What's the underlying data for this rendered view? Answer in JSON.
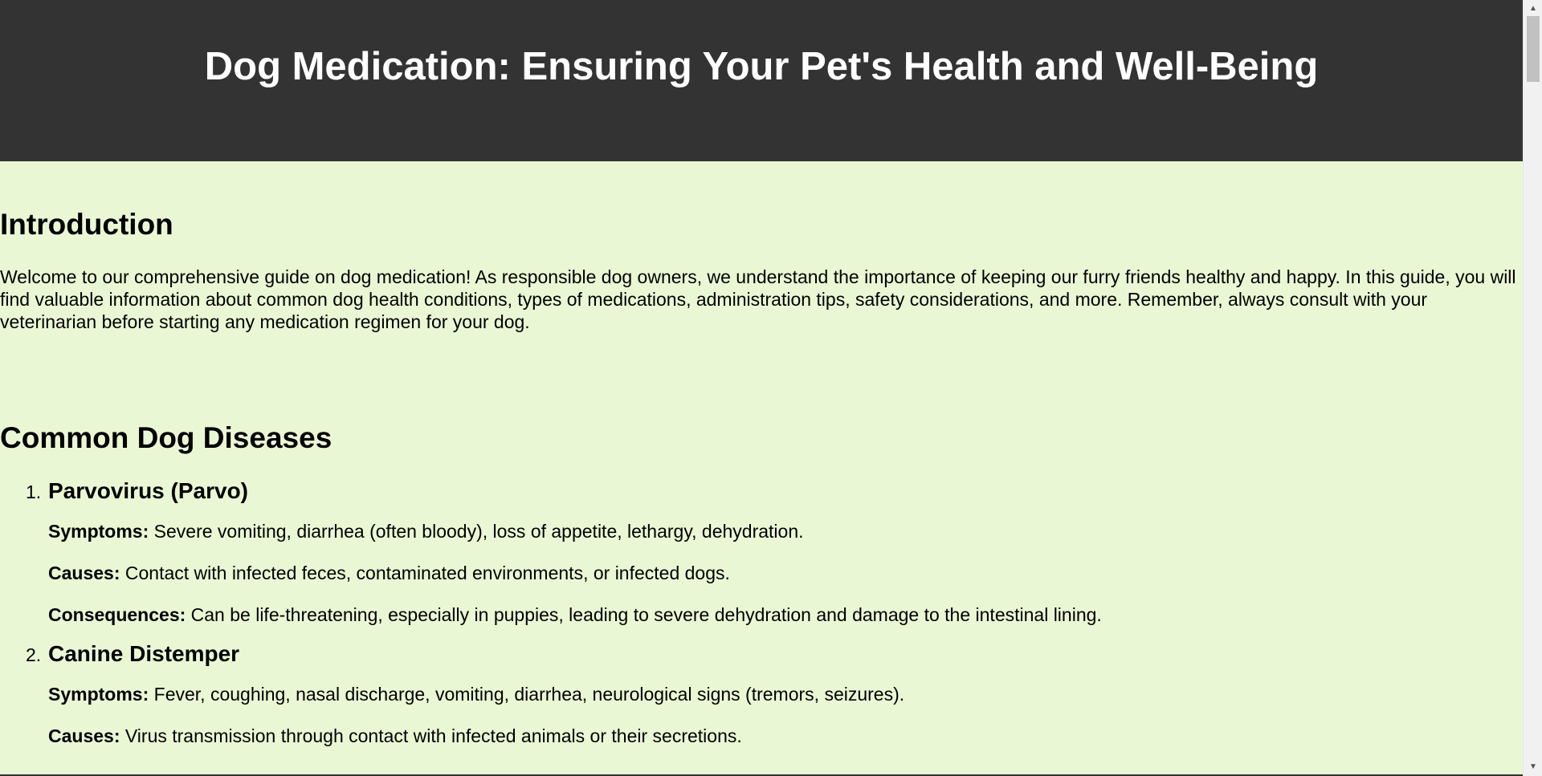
{
  "header": {
    "title": "Dog Medication: Ensuring Your Pet's Health and Well-Being"
  },
  "introduction": {
    "heading": "Introduction",
    "text": "Welcome to our comprehensive guide on dog medication! As responsible dog owners, we understand the importance of keeping our furry friends healthy and happy. In this guide, you will find valuable information about common dog health conditions, types of medications, administration tips, safety considerations, and more. Remember, always consult with your veterinarian before starting any medication regimen for your dog."
  },
  "diseases": {
    "heading": "Common Dog Diseases",
    "items": [
      {
        "number": "1.",
        "title": "Parvovirus (Parvo)",
        "symptoms_label": "Symptoms:",
        "symptoms": "Severe vomiting, diarrhea (often bloody), loss of appetite, lethargy, dehydration.",
        "causes_label": "Causes:",
        "causes": "Contact with infected feces, contaminated environments, or infected dogs.",
        "consequences_label": "Consequences:",
        "consequences": "Can be life-threatening, especially in puppies, leading to severe dehydration and damage to the intestinal lining."
      },
      {
        "number": "2.",
        "title": "Canine Distemper",
        "symptoms_label": "Symptoms:",
        "symptoms": "Fever, coughing, nasal discharge, vomiting, diarrhea, neurological signs (tremors, seizures).",
        "causes_label": "Causes:",
        "causes": "Virus transmission through contact with infected animals or their secretions."
      }
    ]
  },
  "scrollbar": {
    "up_icon": "scroll-up-arrow",
    "down_icon": "scroll-down-arrow"
  },
  "colors": {
    "header_bg": "#333333",
    "page_bg": "#eaf7d4",
    "header_text": "#ffffff"
  }
}
